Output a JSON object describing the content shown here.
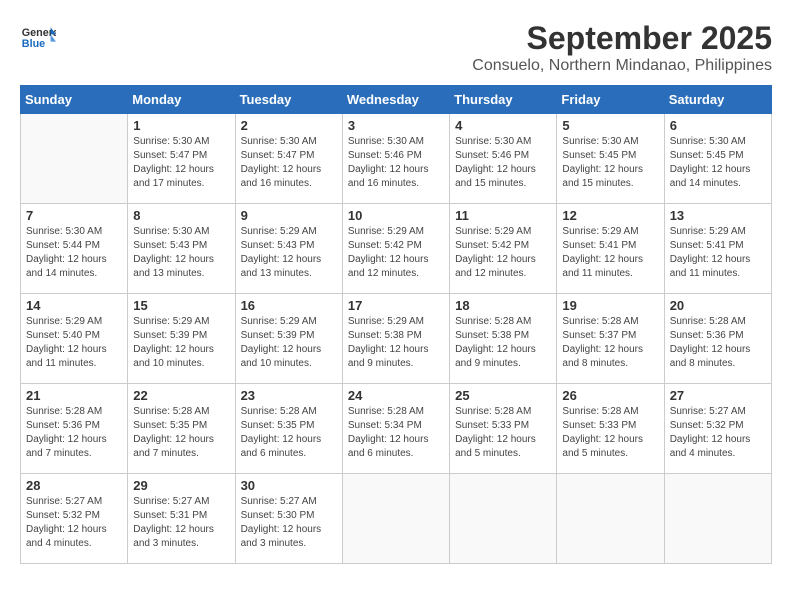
{
  "header": {
    "logo_line1": "General",
    "logo_line2": "Blue",
    "month_year": "September 2025",
    "location": "Consuelo, Northern Mindanao, Philippines"
  },
  "weekdays": [
    "Sunday",
    "Monday",
    "Tuesday",
    "Wednesday",
    "Thursday",
    "Friday",
    "Saturday"
  ],
  "weeks": [
    [
      {
        "day": "",
        "info": ""
      },
      {
        "day": "1",
        "info": "Sunrise: 5:30 AM\nSunset: 5:47 PM\nDaylight: 12 hours\nand 17 minutes."
      },
      {
        "day": "2",
        "info": "Sunrise: 5:30 AM\nSunset: 5:47 PM\nDaylight: 12 hours\nand 16 minutes."
      },
      {
        "day": "3",
        "info": "Sunrise: 5:30 AM\nSunset: 5:46 PM\nDaylight: 12 hours\nand 16 minutes."
      },
      {
        "day": "4",
        "info": "Sunrise: 5:30 AM\nSunset: 5:46 PM\nDaylight: 12 hours\nand 15 minutes."
      },
      {
        "day": "5",
        "info": "Sunrise: 5:30 AM\nSunset: 5:45 PM\nDaylight: 12 hours\nand 15 minutes."
      },
      {
        "day": "6",
        "info": "Sunrise: 5:30 AM\nSunset: 5:45 PM\nDaylight: 12 hours\nand 14 minutes."
      }
    ],
    [
      {
        "day": "7",
        "info": "Sunrise: 5:30 AM\nSunset: 5:44 PM\nDaylight: 12 hours\nand 14 minutes."
      },
      {
        "day": "8",
        "info": "Sunrise: 5:30 AM\nSunset: 5:43 PM\nDaylight: 12 hours\nand 13 minutes."
      },
      {
        "day": "9",
        "info": "Sunrise: 5:29 AM\nSunset: 5:43 PM\nDaylight: 12 hours\nand 13 minutes."
      },
      {
        "day": "10",
        "info": "Sunrise: 5:29 AM\nSunset: 5:42 PM\nDaylight: 12 hours\nand 12 minutes."
      },
      {
        "day": "11",
        "info": "Sunrise: 5:29 AM\nSunset: 5:42 PM\nDaylight: 12 hours\nand 12 minutes."
      },
      {
        "day": "12",
        "info": "Sunrise: 5:29 AM\nSunset: 5:41 PM\nDaylight: 12 hours\nand 11 minutes."
      },
      {
        "day": "13",
        "info": "Sunrise: 5:29 AM\nSunset: 5:41 PM\nDaylight: 12 hours\nand 11 minutes."
      }
    ],
    [
      {
        "day": "14",
        "info": "Sunrise: 5:29 AM\nSunset: 5:40 PM\nDaylight: 12 hours\nand 11 minutes."
      },
      {
        "day": "15",
        "info": "Sunrise: 5:29 AM\nSunset: 5:39 PM\nDaylight: 12 hours\nand 10 minutes."
      },
      {
        "day": "16",
        "info": "Sunrise: 5:29 AM\nSunset: 5:39 PM\nDaylight: 12 hours\nand 10 minutes."
      },
      {
        "day": "17",
        "info": "Sunrise: 5:29 AM\nSunset: 5:38 PM\nDaylight: 12 hours\nand 9 minutes."
      },
      {
        "day": "18",
        "info": "Sunrise: 5:28 AM\nSunset: 5:38 PM\nDaylight: 12 hours\nand 9 minutes."
      },
      {
        "day": "19",
        "info": "Sunrise: 5:28 AM\nSunset: 5:37 PM\nDaylight: 12 hours\nand 8 minutes."
      },
      {
        "day": "20",
        "info": "Sunrise: 5:28 AM\nSunset: 5:36 PM\nDaylight: 12 hours\nand 8 minutes."
      }
    ],
    [
      {
        "day": "21",
        "info": "Sunrise: 5:28 AM\nSunset: 5:36 PM\nDaylight: 12 hours\nand 7 minutes."
      },
      {
        "day": "22",
        "info": "Sunrise: 5:28 AM\nSunset: 5:35 PM\nDaylight: 12 hours\nand 7 minutes."
      },
      {
        "day": "23",
        "info": "Sunrise: 5:28 AM\nSunset: 5:35 PM\nDaylight: 12 hours\nand 6 minutes."
      },
      {
        "day": "24",
        "info": "Sunrise: 5:28 AM\nSunset: 5:34 PM\nDaylight: 12 hours\nand 6 minutes."
      },
      {
        "day": "25",
        "info": "Sunrise: 5:28 AM\nSunset: 5:33 PM\nDaylight: 12 hours\nand 5 minutes."
      },
      {
        "day": "26",
        "info": "Sunrise: 5:28 AM\nSunset: 5:33 PM\nDaylight: 12 hours\nand 5 minutes."
      },
      {
        "day": "27",
        "info": "Sunrise: 5:27 AM\nSunset: 5:32 PM\nDaylight: 12 hours\nand 4 minutes."
      }
    ],
    [
      {
        "day": "28",
        "info": "Sunrise: 5:27 AM\nSunset: 5:32 PM\nDaylight: 12 hours\nand 4 minutes."
      },
      {
        "day": "29",
        "info": "Sunrise: 5:27 AM\nSunset: 5:31 PM\nDaylight: 12 hours\nand 3 minutes."
      },
      {
        "day": "30",
        "info": "Sunrise: 5:27 AM\nSunset: 5:30 PM\nDaylight: 12 hours\nand 3 minutes."
      },
      {
        "day": "",
        "info": ""
      },
      {
        "day": "",
        "info": ""
      },
      {
        "day": "",
        "info": ""
      },
      {
        "day": "",
        "info": ""
      }
    ]
  ]
}
